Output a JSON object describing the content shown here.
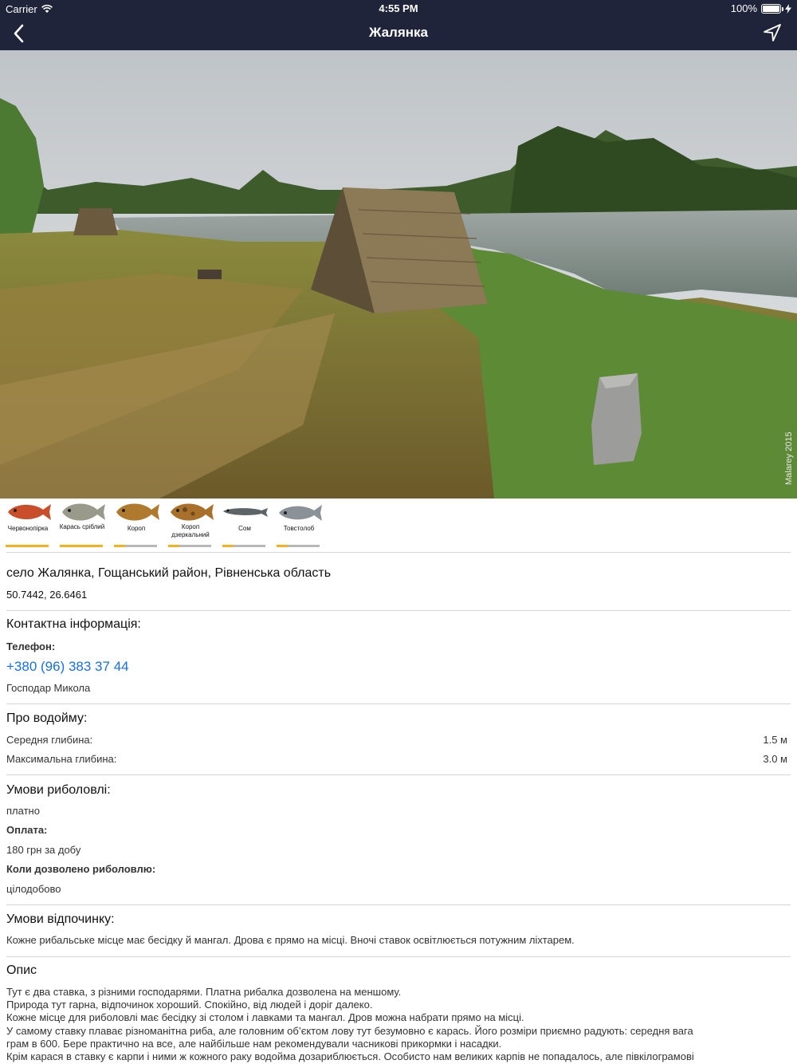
{
  "status_bar": {
    "carrier": "Carrier",
    "time": "4:55 PM",
    "battery": "100%"
  },
  "nav": {
    "title": "Жалянка"
  },
  "photo": {
    "watermark": "Malarey 2015"
  },
  "fish": [
    {
      "name": "Червонопірка",
      "level": 1.0,
      "color": "#c94f2a"
    },
    {
      "name": "Карась сріблий",
      "level": 1.0,
      "color": "#9a9a8a"
    },
    {
      "name": "Короп",
      "level": 0.25,
      "color": "#b07a2e"
    },
    {
      "name": "Короп дзеркальний",
      "level": 0.25,
      "color": "#a8702a"
    },
    {
      "name": "Сом",
      "level": 0.25,
      "color": "#5d6468"
    },
    {
      "name": "Товстолоб",
      "level": 0.25,
      "color": "#8a9297"
    }
  ],
  "location": {
    "address": "село Жалянка, Гощанський район, Рівненська область",
    "coords": "50.7442, 26.6461"
  },
  "contact": {
    "title": "Контактна інформація:",
    "phone_label": "Телефон:",
    "phone": "+380 (96) 383 37 44",
    "owner": "Господар Микола"
  },
  "water": {
    "title": "Про водойму:",
    "avg_depth_label": "Середня глибина:",
    "avg_depth": "1.5 м",
    "max_depth_label": "Максимальна глибина:",
    "max_depth": "3.0 м"
  },
  "fishing": {
    "title": "Умови риболовлі:",
    "type": "платно",
    "payment_label": "Оплата:",
    "payment": "180 грн за добу",
    "when_label": "Коли дозволено риболовлю:",
    "when": "цілодобово"
  },
  "rest": {
    "title": "Умови відпочинку:",
    "text": "Кожне рибальське місце має бесідку й мангал. Дрова є прямо на місці. Вночі ставок освітлюється потужним ліхтарем."
  },
  "description": {
    "title": "Опис",
    "lines": [
      "Тут є два ставка, з різними господарями. Платна рибалка дозволена на меншому.",
      "Природа тут гарна, відпочинок хороший. Спокійно, від людей і доріг далеко.",
      "Кожне місце для риболовлі має бесідку зі столом і лавками та мангал. Дров можна набрати прямо на місці.",
      "У самому ставку плаває різноманітна риба, але головним об’єктом лову тут безумовно є карась. Його розміри приємно радують: середня вага",
      "грам в 600. Бере практично на все, але найбільше нам рекомендували часникові прикормки і насадки.",
      "Крім карася в ставку є карпи і ними ж кожного раку водойма дозариблюється. Особисто нам великих карпів не попадалось, але півкілограмові"
    ]
  }
}
